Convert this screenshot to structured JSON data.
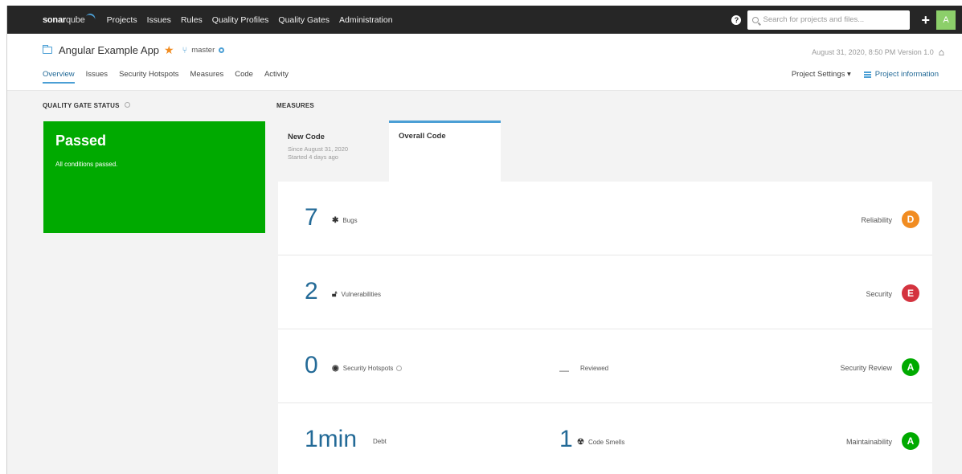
{
  "topnav": {
    "logo_sonar": "sonar",
    "logo_qube": "qube",
    "links": [
      "Projects",
      "Issues",
      "Rules",
      "Quality Profiles",
      "Quality Gates",
      "Administration"
    ],
    "help_icon": "?",
    "search_placeholder": "Search for projects and files...",
    "plus": "+",
    "avatar": "A"
  },
  "project": {
    "name": "Angular Example App",
    "branch": "master",
    "meta": "August 31, 2020, 8:50 PM  Version 1.0",
    "tabs": [
      "Overview",
      "Issues",
      "Security Hotspots",
      "Measures",
      "Code",
      "Activity"
    ],
    "settings": "Project Settings ▾",
    "info": "Project information"
  },
  "quality_gate": {
    "title": "QUALITY GATE STATUS",
    "status": "Passed",
    "subtitle": "All conditions passed.",
    "color": "#00aa00"
  },
  "measures": {
    "title": "MEASURES",
    "new_code": {
      "title": "New Code",
      "since": "Since August 31, 2020",
      "started": "Started 4 days ago"
    },
    "overall_code": {
      "title": "Overall Code"
    },
    "rows": {
      "bugs": {
        "value": "7",
        "label": "Bugs",
        "rating_label": "Reliability",
        "rating": "D",
        "color": "#f18c21"
      },
      "vulns": {
        "value": "2",
        "label": "Vulnerabilities",
        "rating_label": "Security",
        "rating": "E",
        "color": "#d4333f"
      },
      "hotspots": {
        "value": "0",
        "label": "Security Hotspots",
        "dash": "—",
        "reviewed": "Reviewed",
        "rating_label": "Security Review",
        "rating": "A",
        "color": "#00aa00"
      },
      "debt": {
        "value": "1min",
        "label": "Debt",
        "smells_value": "1",
        "smells_label": "Code Smells",
        "rating_label": "Maintainability",
        "rating": "A",
        "color": "#00aa00"
      }
    }
  }
}
